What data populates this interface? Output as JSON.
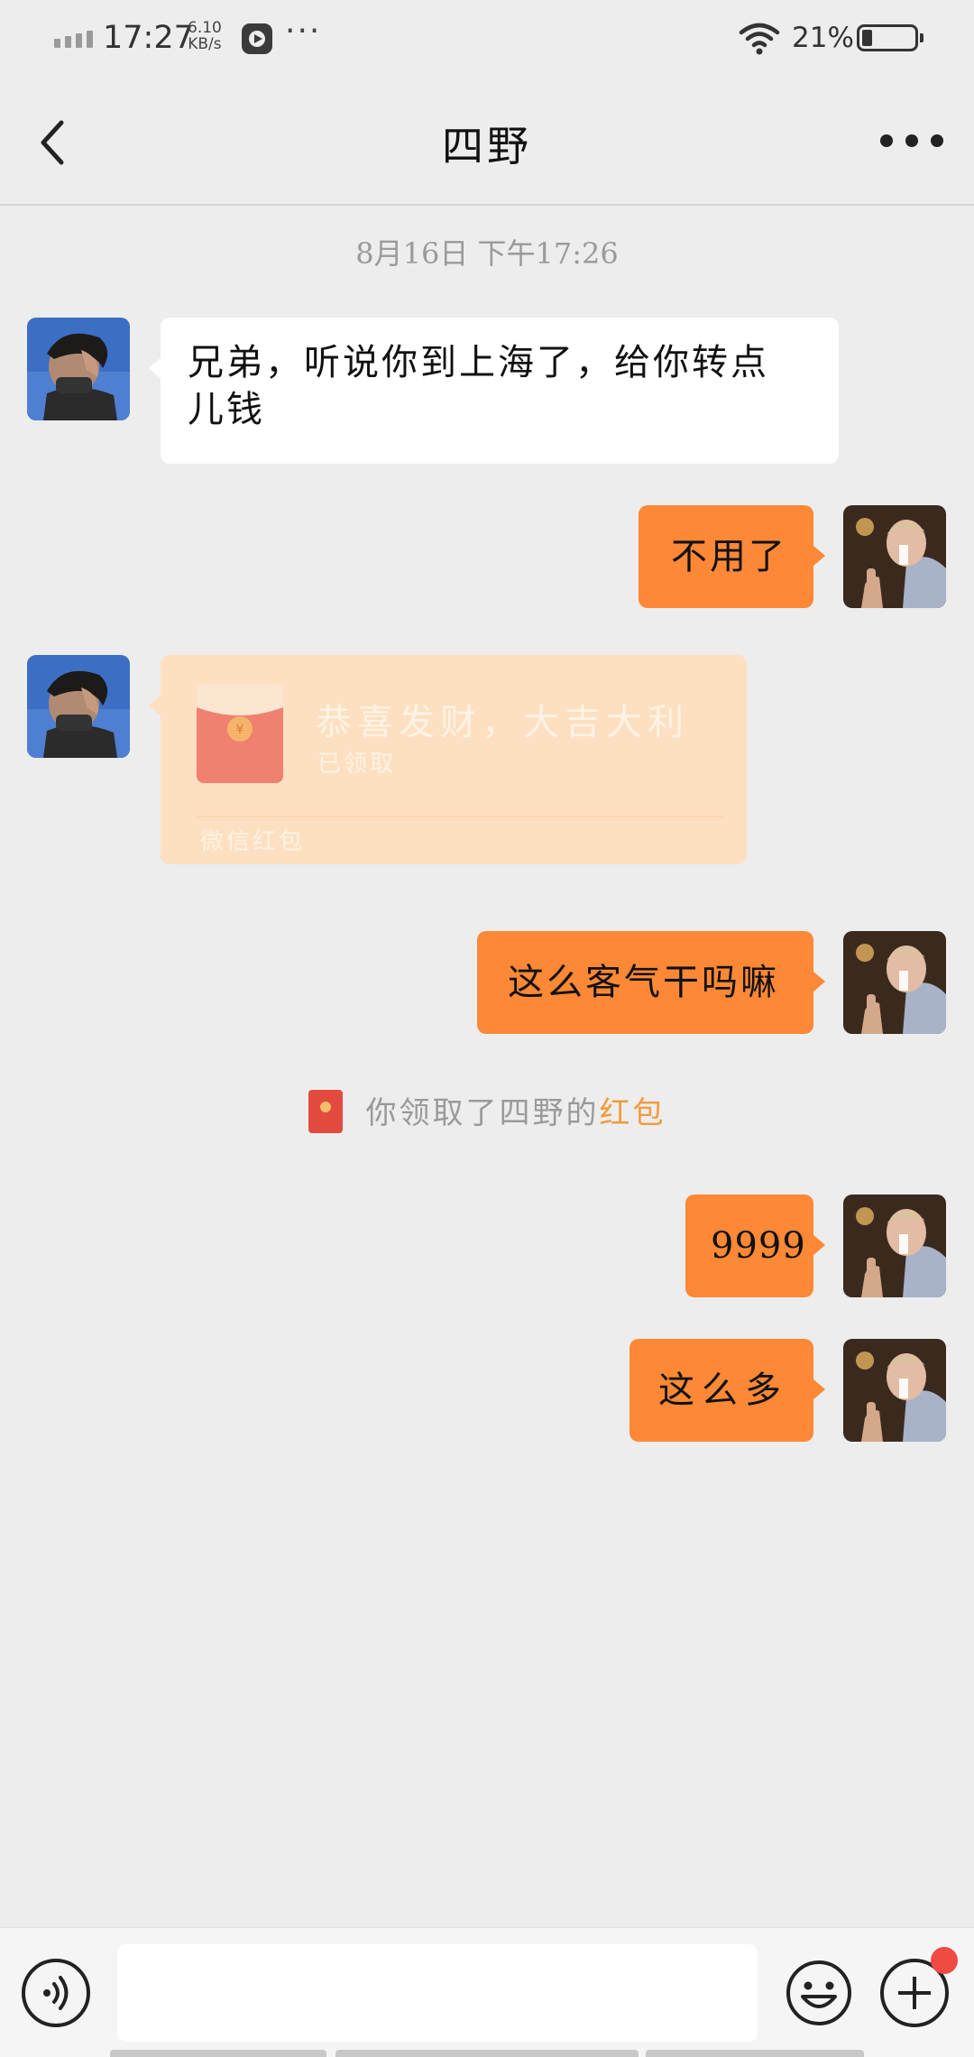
{
  "status_bar": {
    "time": "17:27",
    "net_speed_value": "6.10",
    "net_speed_unit": "KB/s",
    "more": "···",
    "battery_percent": "21%"
  },
  "nav": {
    "title": "四野"
  },
  "chat": {
    "timestamp": "8月16日 下午17:26",
    "messages": [
      {
        "sender": "other",
        "type": "text",
        "text_line1": "兄弟，听说你到上海了，给你转点",
        "text_line2": "儿钱"
      },
      {
        "sender": "me",
        "type": "text",
        "text": "不用了"
      },
      {
        "sender": "other",
        "type": "red_packet",
        "title": "恭喜发财，大吉大利",
        "status": "已领取",
        "footer": "微信红包"
      },
      {
        "sender": "me",
        "type": "text",
        "text": "这么客气干吗嘛"
      },
      {
        "sender": "me",
        "type": "text",
        "text": "9999"
      },
      {
        "sender": "me",
        "type": "text",
        "text": "这么多"
      }
    ],
    "system_notice": {
      "prefix": "你领取了四野的",
      "link": "红包"
    }
  },
  "input_bar": {
    "value": "",
    "placeholder": ""
  },
  "colors": {
    "background": "#ededed",
    "my_bubble": "#fd8836",
    "other_bubble": "#ffffff",
    "red_packet_claimed": "#fde0c1",
    "notice_link": "#f39a3d",
    "badge": "#f04a45"
  },
  "icons": [
    "signal-icon",
    "play-app-icon",
    "wifi-icon",
    "battery-icon",
    "back-arrow-icon",
    "more-icon",
    "red-packet-icon",
    "voice-icon",
    "emoji-icon",
    "plus-icon"
  ]
}
